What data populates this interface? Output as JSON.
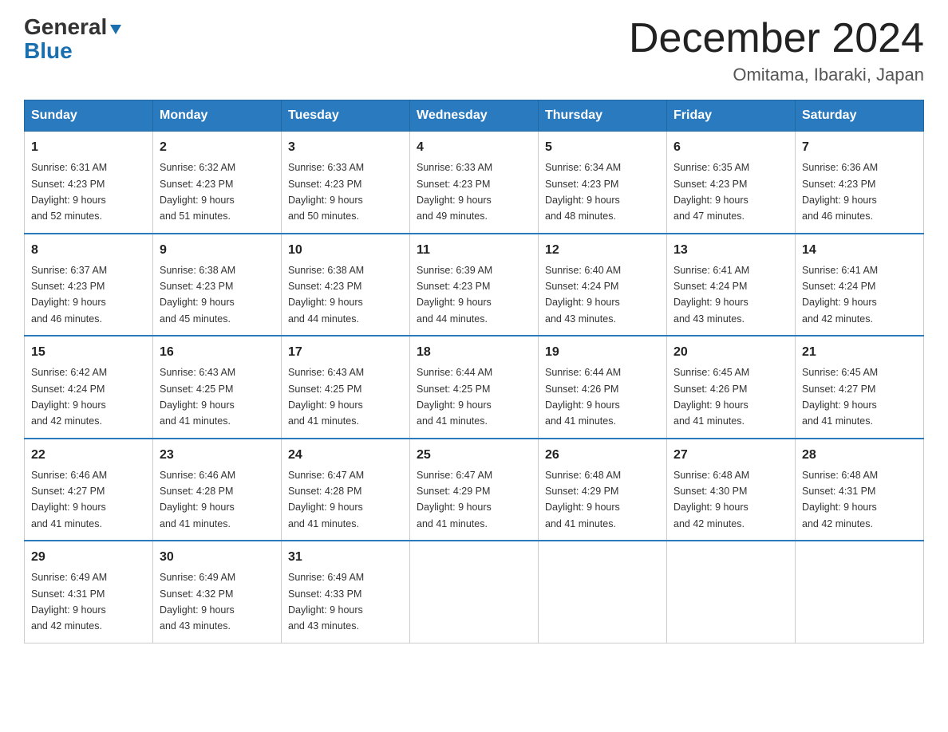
{
  "header": {
    "logo_line1": "General",
    "logo_line2": "Blue",
    "month_title": "December 2024",
    "location": "Omitama, Ibaraki, Japan"
  },
  "days_of_week": [
    "Sunday",
    "Monday",
    "Tuesday",
    "Wednesday",
    "Thursday",
    "Friday",
    "Saturday"
  ],
  "weeks": [
    [
      {
        "day": "1",
        "sunrise": "6:31 AM",
        "sunset": "4:23 PM",
        "daylight": "9 hours and 52 minutes."
      },
      {
        "day": "2",
        "sunrise": "6:32 AM",
        "sunset": "4:23 PM",
        "daylight": "9 hours and 51 minutes."
      },
      {
        "day": "3",
        "sunrise": "6:33 AM",
        "sunset": "4:23 PM",
        "daylight": "9 hours and 50 minutes."
      },
      {
        "day": "4",
        "sunrise": "6:33 AM",
        "sunset": "4:23 PM",
        "daylight": "9 hours and 49 minutes."
      },
      {
        "day": "5",
        "sunrise": "6:34 AM",
        "sunset": "4:23 PM",
        "daylight": "9 hours and 48 minutes."
      },
      {
        "day": "6",
        "sunrise": "6:35 AM",
        "sunset": "4:23 PM",
        "daylight": "9 hours and 47 minutes."
      },
      {
        "day": "7",
        "sunrise": "6:36 AM",
        "sunset": "4:23 PM",
        "daylight": "9 hours and 46 minutes."
      }
    ],
    [
      {
        "day": "8",
        "sunrise": "6:37 AM",
        "sunset": "4:23 PM",
        "daylight": "9 hours and 46 minutes."
      },
      {
        "day": "9",
        "sunrise": "6:38 AM",
        "sunset": "4:23 PM",
        "daylight": "9 hours and 45 minutes."
      },
      {
        "day": "10",
        "sunrise": "6:38 AM",
        "sunset": "4:23 PM",
        "daylight": "9 hours and 44 minutes."
      },
      {
        "day": "11",
        "sunrise": "6:39 AM",
        "sunset": "4:23 PM",
        "daylight": "9 hours and 44 minutes."
      },
      {
        "day": "12",
        "sunrise": "6:40 AM",
        "sunset": "4:24 PM",
        "daylight": "9 hours and 43 minutes."
      },
      {
        "day": "13",
        "sunrise": "6:41 AM",
        "sunset": "4:24 PM",
        "daylight": "9 hours and 43 minutes."
      },
      {
        "day": "14",
        "sunrise": "6:41 AM",
        "sunset": "4:24 PM",
        "daylight": "9 hours and 42 minutes."
      }
    ],
    [
      {
        "day": "15",
        "sunrise": "6:42 AM",
        "sunset": "4:24 PM",
        "daylight": "9 hours and 42 minutes."
      },
      {
        "day": "16",
        "sunrise": "6:43 AM",
        "sunset": "4:25 PM",
        "daylight": "9 hours and 41 minutes."
      },
      {
        "day": "17",
        "sunrise": "6:43 AM",
        "sunset": "4:25 PM",
        "daylight": "9 hours and 41 minutes."
      },
      {
        "day": "18",
        "sunrise": "6:44 AM",
        "sunset": "4:25 PM",
        "daylight": "9 hours and 41 minutes."
      },
      {
        "day": "19",
        "sunrise": "6:44 AM",
        "sunset": "4:26 PM",
        "daylight": "9 hours and 41 minutes."
      },
      {
        "day": "20",
        "sunrise": "6:45 AM",
        "sunset": "4:26 PM",
        "daylight": "9 hours and 41 minutes."
      },
      {
        "day": "21",
        "sunrise": "6:45 AM",
        "sunset": "4:27 PM",
        "daylight": "9 hours and 41 minutes."
      }
    ],
    [
      {
        "day": "22",
        "sunrise": "6:46 AM",
        "sunset": "4:27 PM",
        "daylight": "9 hours and 41 minutes."
      },
      {
        "day": "23",
        "sunrise": "6:46 AM",
        "sunset": "4:28 PM",
        "daylight": "9 hours and 41 minutes."
      },
      {
        "day": "24",
        "sunrise": "6:47 AM",
        "sunset": "4:28 PM",
        "daylight": "9 hours and 41 minutes."
      },
      {
        "day": "25",
        "sunrise": "6:47 AM",
        "sunset": "4:29 PM",
        "daylight": "9 hours and 41 minutes."
      },
      {
        "day": "26",
        "sunrise": "6:48 AM",
        "sunset": "4:29 PM",
        "daylight": "9 hours and 41 minutes."
      },
      {
        "day": "27",
        "sunrise": "6:48 AM",
        "sunset": "4:30 PM",
        "daylight": "9 hours and 42 minutes."
      },
      {
        "day": "28",
        "sunrise": "6:48 AM",
        "sunset": "4:31 PM",
        "daylight": "9 hours and 42 minutes."
      }
    ],
    [
      {
        "day": "29",
        "sunrise": "6:49 AM",
        "sunset": "4:31 PM",
        "daylight": "9 hours and 42 minutes."
      },
      {
        "day": "30",
        "sunrise": "6:49 AM",
        "sunset": "4:32 PM",
        "daylight": "9 hours and 43 minutes."
      },
      {
        "day": "31",
        "sunrise": "6:49 AM",
        "sunset": "4:33 PM",
        "daylight": "9 hours and 43 minutes."
      },
      null,
      null,
      null,
      null
    ]
  ],
  "labels": {
    "sunrise": "Sunrise:",
    "sunset": "Sunset:",
    "daylight": "Daylight:"
  }
}
